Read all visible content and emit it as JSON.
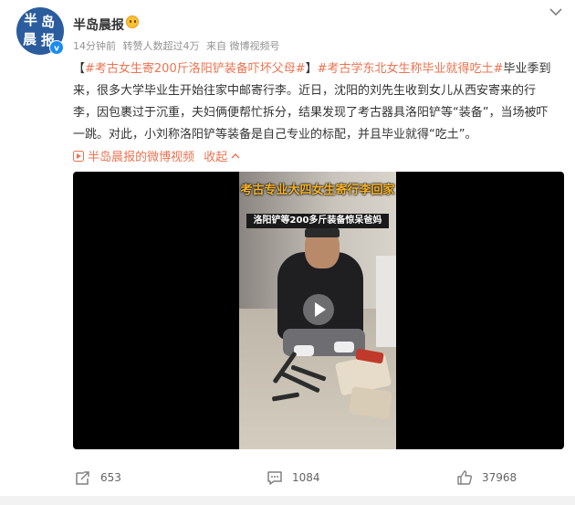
{
  "account": {
    "name": "半岛晨报",
    "avatar_text": [
      "半",
      "岛",
      "晨",
      "报"
    ]
  },
  "meta": {
    "time": "14分钟前",
    "reposts_hint": "转赞人数超过4万",
    "source": "来自 微博视频号"
  },
  "post": {
    "topic1": "#考古女生寄200斤洛阳铲装备吓坏父母#",
    "topic2": "#考古学东北女生称毕业就得吃土#",
    "body": "毕业季到来，很多大学毕业生开始往家中邮寄行李。近日，沈阳的刘先生收到女儿从西安寄来的行李，因包裹过于沉重，夫妇俩便帮忙拆分，结果发现了考古器具洛阳铲等“装备”，当场被吓一跳。对此，小刘称洛阳铲等装备是自己专业的标配，并且毕业就得“吃土”。",
    "open_bracket": "【",
    "close_bracket": "】"
  },
  "video_source": {
    "label": "半岛晨报的微博视频",
    "collapse": "收起"
  },
  "video": {
    "overlay_title": "考古专业大四女生寄行李回家",
    "overlay_subtitle": "洛阳铲等200多斤装备惊呆爸妈"
  },
  "actions": {
    "share_count": "653",
    "comment_count": "1084",
    "like_count": "37968"
  },
  "colors": {
    "accent": "#eb7350",
    "brand_blue": "#2b5c9e"
  },
  "icons": [
    "avatar",
    "verified-badge-icon",
    "emoji-badge-icon",
    "chevron-down-icon",
    "video-play-mini-icon",
    "play-icon",
    "share-icon",
    "comment-icon",
    "like-icon"
  ]
}
